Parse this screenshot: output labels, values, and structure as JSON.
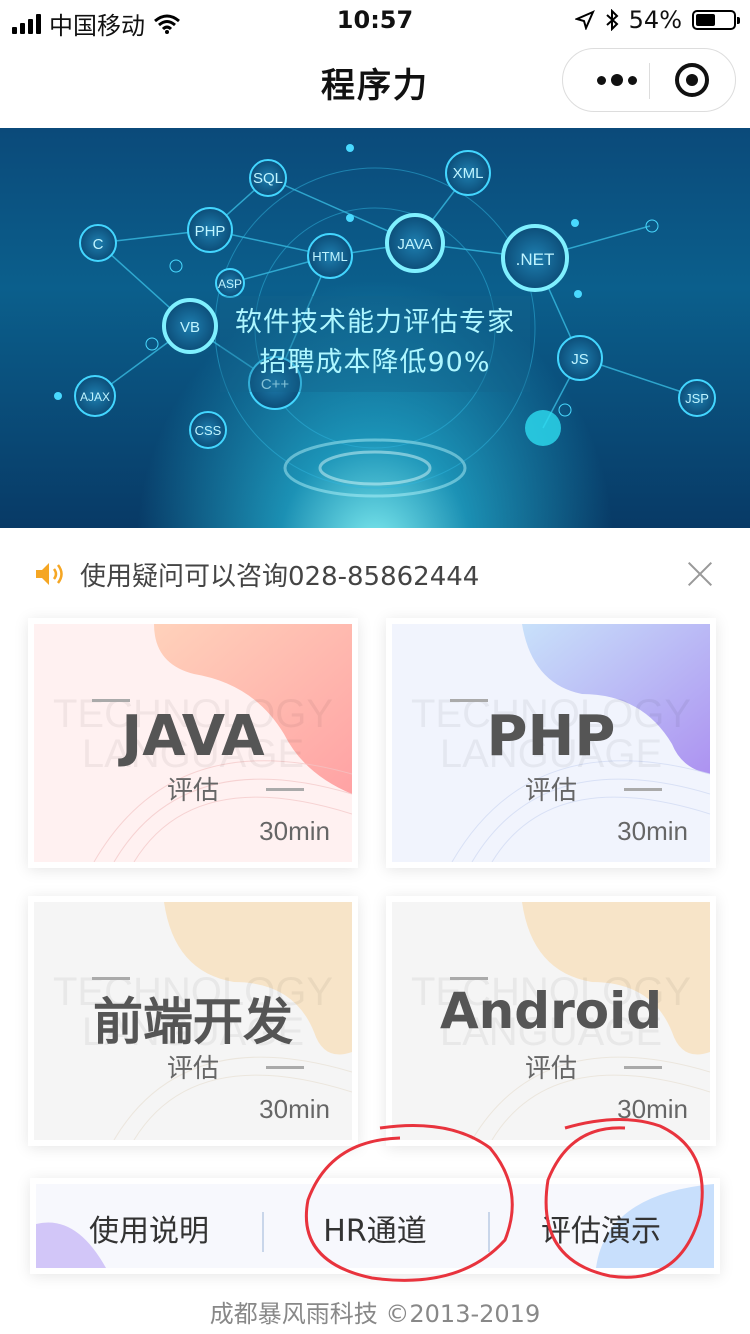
{
  "status_bar": {
    "carrier": "中国移动",
    "time": "10:57",
    "battery_percent": "54%",
    "battery_level": 0.54
  },
  "nav": {
    "title": "程序力",
    "more_icon": "more-dots-icon",
    "close_icon": "target-circle-icon"
  },
  "banner": {
    "line1": "软件技术能力评估专家",
    "line2": "招聘成本降低90%",
    "nodes": [
      "SQL",
      "XML",
      "PHP",
      "HTML",
      "JAVA",
      ".NET",
      "C",
      "ASP",
      "VB",
      "JS",
      "C++",
      "AJAX",
      "CSS",
      "JSP"
    ]
  },
  "notice": {
    "text": "使用疑问可以咨询028-85862444",
    "icon": "speaker-icon",
    "close_icon": "close-icon"
  },
  "cards": [
    {
      "title": "JAVA",
      "subtitle": "评估",
      "duration": "30min",
      "watermark1": "TECHNOLOGY",
      "watermark2": "LANGUAGE"
    },
    {
      "title": "PHP",
      "subtitle": "评估",
      "duration": "30min",
      "watermark1": "TECHNOLOGY",
      "watermark2": "LANGUAGE"
    },
    {
      "title": "前端开发",
      "subtitle": "评估",
      "duration": "30min",
      "watermark1": "TECHNOLOGY",
      "watermark2": "LANGUAGE"
    },
    {
      "title": "Android",
      "subtitle": "评估",
      "duration": "30min",
      "watermark1": "TECHNOLOGY",
      "watermark2": "LANGUAGE"
    }
  ],
  "bottom_bar": {
    "items": [
      "使用说明",
      "HR通道",
      "评估演示"
    ]
  },
  "footer": {
    "copyright": "成都暴风雨科技 ©2013-2019"
  },
  "colors": {
    "accent_red": "#e8333d",
    "banner_text": "#aef6ff"
  }
}
